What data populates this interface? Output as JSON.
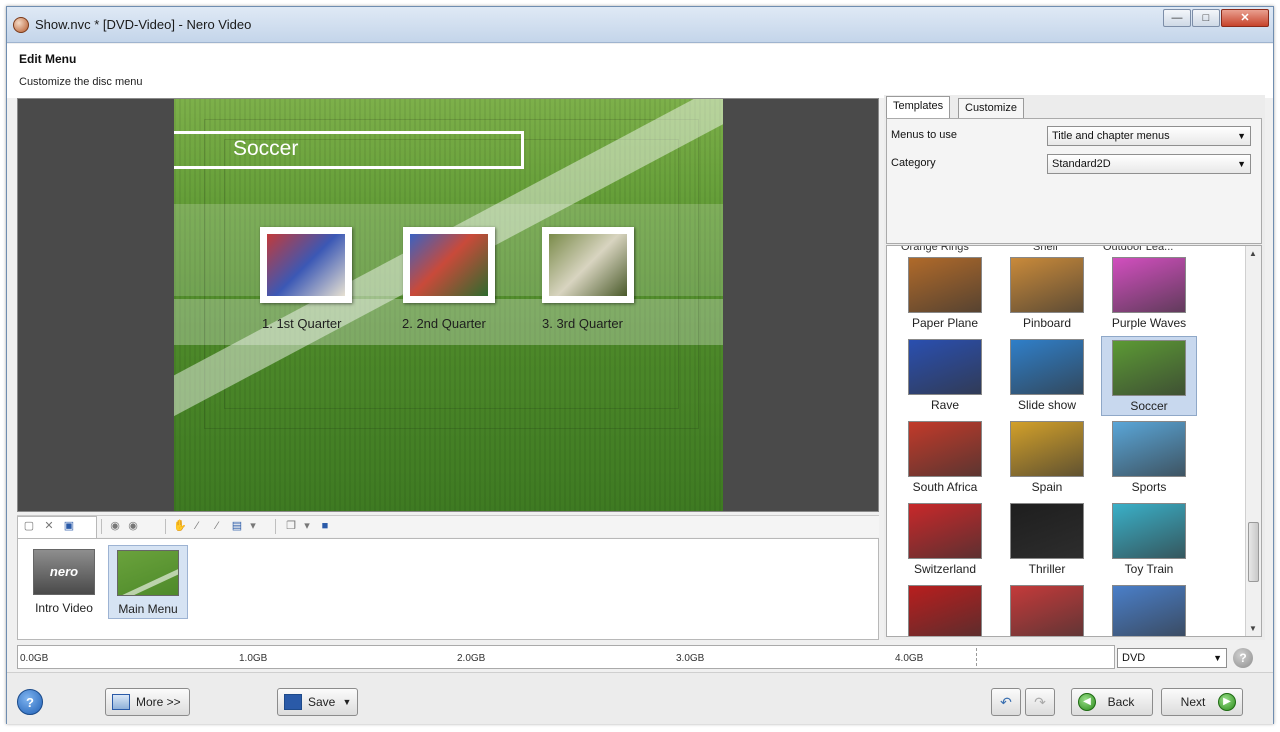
{
  "window": {
    "title": "Show.nvc * [DVD-Video] - Nero Video",
    "controls": {
      "minimize": "—",
      "maximize": "□",
      "close": "✕"
    }
  },
  "header": {
    "title": "Edit Menu",
    "subtitle": "Customize the disc menu"
  },
  "preview": {
    "menu_title": "Soccer",
    "chapters": [
      "1. 1st Quarter",
      "2. 2nd Quarter",
      "3. 3rd Quarter"
    ]
  },
  "timeline": {
    "items": [
      {
        "label": "Intro Video",
        "thumb_text": "nero",
        "selected": false
      },
      {
        "label": "Main Menu",
        "selected": true
      }
    ]
  },
  "right_panel": {
    "tabs": [
      {
        "label": "Templates",
        "active": true
      },
      {
        "label": "Customize",
        "active": false
      }
    ],
    "menus_to_use": {
      "label": "Menus to use",
      "value": "Title and chapter menus"
    },
    "category": {
      "label": "Category",
      "value": "Standard2D"
    },
    "gallery": {
      "partial_labels": [
        "Orange Rings",
        "Shelf",
        "Outdoor Lea..."
      ],
      "templates": [
        {
          "label": "Paper Plane",
          "color": "#b06a2a",
          "selected": false
        },
        {
          "label": "Pinboard",
          "color": "#c98a3a",
          "selected": false
        },
        {
          "label": "Purple Waves",
          "color": "#d24fbf",
          "selected": false
        },
        {
          "label": "Rave",
          "color": "#2a4fb0",
          "selected": false
        },
        {
          "label": "Slide show",
          "color": "#2f7fc9",
          "selected": false
        },
        {
          "label": "Soccer",
          "color": "#5c9a34",
          "selected": true
        },
        {
          "label": "South Africa",
          "color": "#c23a2a",
          "selected": false
        },
        {
          "label": "Spain",
          "color": "#d2a02a",
          "selected": false
        },
        {
          "label": "Sports",
          "color": "#5aa6d8",
          "selected": false
        },
        {
          "label": "Switzerland",
          "color": "#c8282a",
          "selected": false
        },
        {
          "label": "Thriller",
          "color": "#1e1e1e",
          "selected": false
        },
        {
          "label": "Toy Train",
          "color": "#3ab0c8",
          "selected": false
        },
        {
          "label": "",
          "color": "#b81e1e",
          "selected": false
        },
        {
          "label": "",
          "color": "#c43a3a",
          "selected": false
        },
        {
          "label": "",
          "color": "#4a7fc9",
          "selected": false
        }
      ]
    }
  },
  "capacity": {
    "ticks": [
      "0.0GB",
      "1.0GB",
      "2.0GB",
      "3.0GB",
      "4.0GB"
    ],
    "disc_type": "DVD"
  },
  "bottom": {
    "help": "?",
    "more_label": "More >>",
    "save_label": "Save",
    "back_label": "Back",
    "next_label": "Next"
  }
}
